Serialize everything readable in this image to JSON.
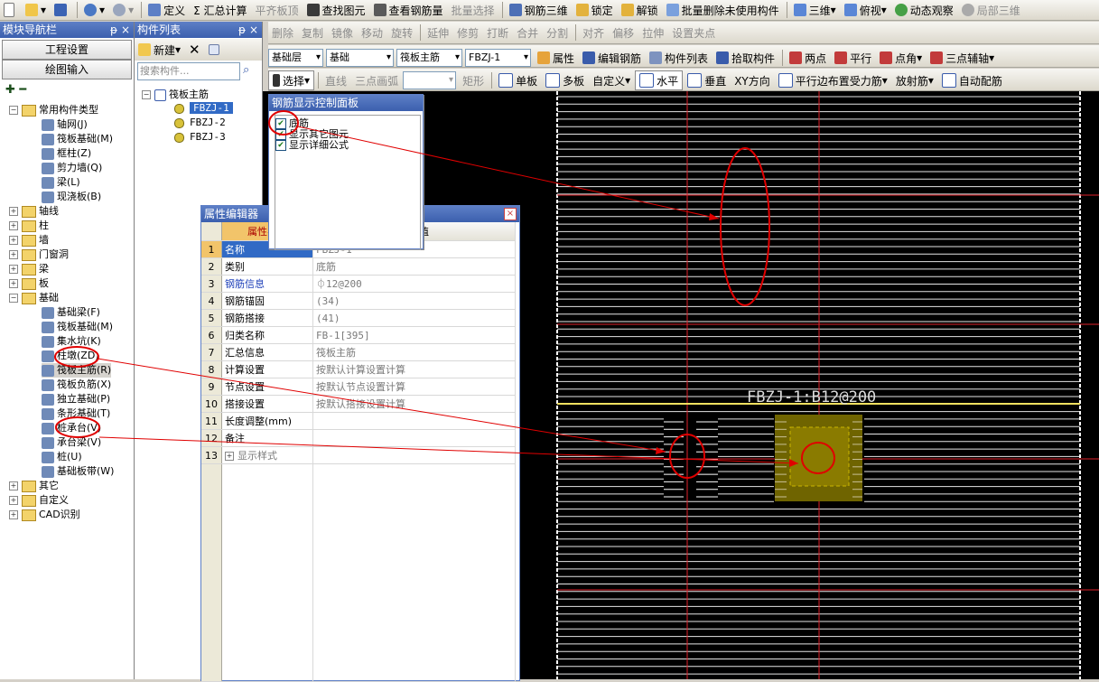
{
  "toolbar1": {
    "items": [
      "定义",
      "Σ 汇总计算",
      "平齐板顶",
      "查找图元",
      "查看钢筋量",
      "批量选择",
      "钢筋三维",
      "锁定",
      "解锁",
      "批量删除未使用构件",
      "三维",
      "俯视",
      "动态观察",
      "局部三维"
    ]
  },
  "toolbar2": {
    "items": [
      "删除",
      "复制",
      "镜像",
      "移动",
      "旋转",
      "延伸",
      "修剪",
      "打断",
      "合并",
      "分割",
      "对齐",
      "偏移",
      "拉伸",
      "设置夹点"
    ]
  },
  "toolbar3": {
    "floor": "基础层",
    "category": "基础",
    "type": "筏板主筋",
    "component": "FBZJ-1",
    "items": [
      "属性",
      "编辑钢筋",
      "构件列表",
      "拾取构件",
      "两点",
      "平行",
      "点角",
      "三点辅轴"
    ]
  },
  "toolbar4": {
    "items": [
      "选择",
      "直线",
      "三点画弧",
      "矩形",
      "单板",
      "多板",
      "自定义",
      "水平",
      "垂直",
      "XY方向",
      "平行边布置受力筋",
      "放射筋",
      "自动配筋"
    ]
  },
  "nav": {
    "title": "模块导航栏",
    "btn_project": "工程设置",
    "btn_draw": "绘图输入",
    "tree": [
      {
        "t": "常用构件类型",
        "lvl": 0,
        "fold": true,
        "exp": "−"
      },
      {
        "t": "轴网(J)",
        "lvl": 1
      },
      {
        "t": "筏板基础(M)",
        "lvl": 1
      },
      {
        "t": "框柱(Z)",
        "lvl": 1
      },
      {
        "t": "剪力墙(Q)",
        "lvl": 1
      },
      {
        "t": "梁(L)",
        "lvl": 1
      },
      {
        "t": "现浇板(B)",
        "lvl": 1
      },
      {
        "t": "轴线",
        "lvl": 0,
        "fold": true,
        "exp": "+"
      },
      {
        "t": "柱",
        "lvl": 0,
        "fold": true,
        "exp": "+"
      },
      {
        "t": "墙",
        "lvl": 0,
        "fold": true,
        "exp": "+"
      },
      {
        "t": "门窗洞",
        "lvl": 0,
        "fold": true,
        "exp": "+"
      },
      {
        "t": "梁",
        "lvl": 0,
        "fold": true,
        "exp": "+"
      },
      {
        "t": "板",
        "lvl": 0,
        "fold": true,
        "exp": "+"
      },
      {
        "t": "基础",
        "lvl": 0,
        "fold": true,
        "exp": "−"
      },
      {
        "t": "基础梁(F)",
        "lvl": 1
      },
      {
        "t": "筏板基础(M)",
        "lvl": 1
      },
      {
        "t": "集水坑(K)",
        "lvl": 1
      },
      {
        "t": "柱墩(ZD)",
        "lvl": 1
      },
      {
        "t": "筏板主筋(R)",
        "lvl": 1,
        "sel": true
      },
      {
        "t": "筏板负筋(X)",
        "lvl": 1
      },
      {
        "t": "独立基础(P)",
        "lvl": 1
      },
      {
        "t": "条形基础(T)",
        "lvl": 1
      },
      {
        "t": "桩承台(V)",
        "lvl": 1
      },
      {
        "t": "承台梁(V)",
        "lvl": 1
      },
      {
        "t": "桩(U)",
        "lvl": 1
      },
      {
        "t": "基础板带(W)",
        "lvl": 1
      },
      {
        "t": "其它",
        "lvl": 0,
        "fold": true,
        "exp": "+"
      },
      {
        "t": "自定义",
        "lvl": 0,
        "fold": true,
        "exp": "+"
      },
      {
        "t": "CAD识别",
        "lvl": 0,
        "fold": true,
        "exp": "+"
      }
    ]
  },
  "list": {
    "title": "构件列表",
    "new_label": "新建",
    "search_placeholder": "搜索构件...",
    "root": "筏板主筋",
    "items": [
      "FBZJ-1",
      "FBZJ-2",
      "FBZJ-3"
    ]
  },
  "rebar_panel": {
    "title": "钢筋显示控制面板",
    "items": [
      "底筋",
      "显示其它图元",
      "显示详细公式"
    ]
  },
  "prop": {
    "title": "属性编辑器",
    "col_name": "属性名称",
    "col_value": "属性值",
    "rows": [
      {
        "n": "1",
        "k": "名称",
        "v": "FBZJ-1",
        "sel": true
      },
      {
        "n": "2",
        "k": "类别",
        "v": "底筋"
      },
      {
        "n": "3",
        "k": "钢筋信息",
        "v": "⏀12@200",
        "blue": true
      },
      {
        "n": "4",
        "k": "钢筋锚固",
        "v": "(34)"
      },
      {
        "n": "5",
        "k": "钢筋搭接",
        "v": "(41)"
      },
      {
        "n": "6",
        "k": "归类名称",
        "v": "FB-1[395]"
      },
      {
        "n": "7",
        "k": "汇总信息",
        "v": "筏板主筋"
      },
      {
        "n": "8",
        "k": "计算设置",
        "v": "按默认计算设置计算"
      },
      {
        "n": "9",
        "k": "节点设置",
        "v": "按默认节点设置计算"
      },
      {
        "n": "10",
        "k": "搭接设置",
        "v": "按默认搭接设置计算"
      },
      {
        "n": "11",
        "k": "长度调整(mm)",
        "v": ""
      },
      {
        "n": "12",
        "k": "备注",
        "v": ""
      },
      {
        "n": "13",
        "k": "显示样式",
        "v": "",
        "plus": true
      }
    ]
  },
  "canvas": {
    "label": "FBZJ-1:B12@200"
  },
  "colors": {
    "canvas_bg": "#000000",
    "rebar": "#ffffff",
    "axis": "#e0212a",
    "annot": "#e00000",
    "pile": "#6f6400"
  }
}
